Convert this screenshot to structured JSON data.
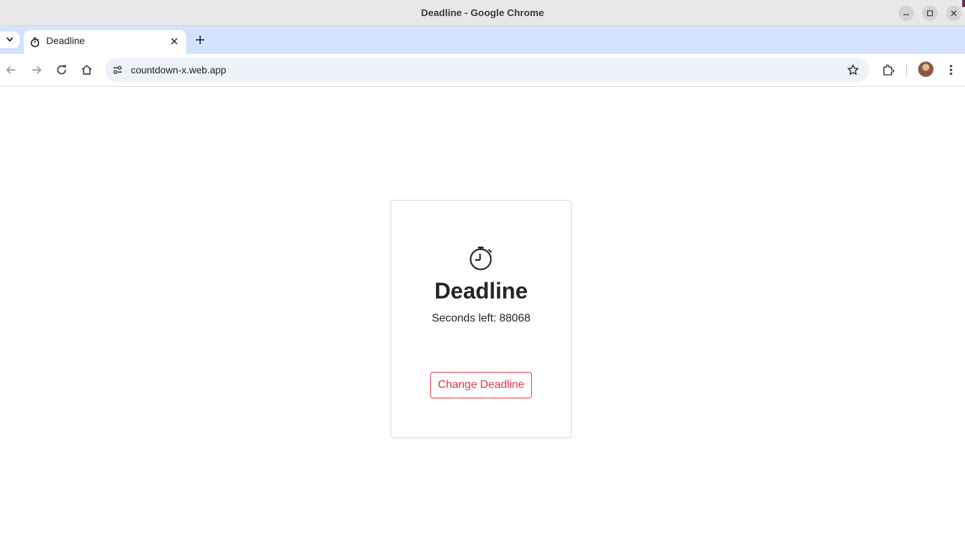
{
  "window": {
    "title": "Deadline - Google Chrome"
  },
  "tabs": [
    {
      "title": "Deadline",
      "active": true
    }
  ],
  "toolbar": {
    "url": "countdown-x.web.app"
  },
  "page": {
    "heading": "Deadline",
    "seconds_label": "Seconds left:",
    "seconds_value": "88068",
    "change_button_label": "Change Deadline"
  },
  "colors": {
    "tabstrip_bg": "#d3e3fd",
    "button_accent": "#dc3545",
    "text": "#212529"
  },
  "icons": [
    "minimize-icon",
    "maximize-icon",
    "close-icon",
    "tab-list-chevron-icon",
    "stopwatch-favicon",
    "tab-close-icon",
    "new-tab-plus-icon",
    "back-arrow-icon",
    "forward-arrow-icon",
    "reload-icon",
    "home-icon",
    "site-info-icon",
    "bookmark-star-icon",
    "extensions-puzzle-icon",
    "profile-avatar",
    "kebab-menu-icon",
    "stopwatch-icon"
  ]
}
